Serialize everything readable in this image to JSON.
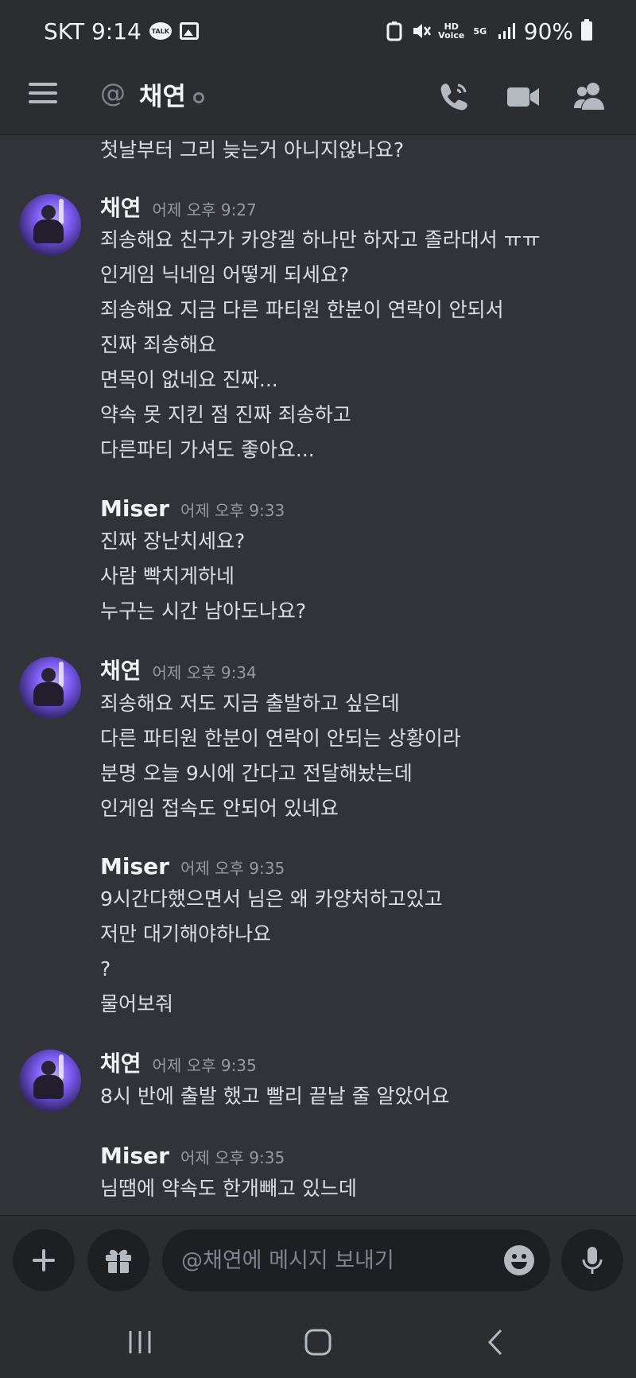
{
  "status_bar": {
    "carrier_time": "SKT 9:14",
    "talk_badge": "TALK",
    "hd_voice": "HD Voice",
    "network": "5G",
    "battery": "90%"
  },
  "header": {
    "at_symbol": "@",
    "channel_name": "채연"
  },
  "messages": {
    "prev_line": "첫날부터 그리 늦는거 아니지않나요?",
    "groups": [
      {
        "author": "채연",
        "time": "어제 오후 9:27",
        "lines": [
          "죄송해요 친구가 카양겔 하나만 하자고 졸라대서 ㅠㅠ",
          "인게임 닉네임 어떻게 되세요?",
          "죄송해요 지금 다른 파티원 한분이 연락이 안되서",
          "진짜 죄송해요",
          "면목이 없네요 진짜...",
          "약속 못 지킨 점 진짜 죄송하고",
          "다른파티 가셔도 좋아요..."
        ]
      },
      {
        "author": "Miser",
        "time": "어제 오후 9:33",
        "lines": [
          "진짜 장난치세요?",
          "사람 빡치게하네",
          "누구는 시간 남아도나요?"
        ]
      },
      {
        "author": "채연",
        "time": "어제 오후 9:34",
        "lines": [
          "죄송해요 저도 지금 출발하고 싶은데",
          "다른 파티원 한분이 연락이 안되는 상황이라",
          "분명 오늘 9시에 간다고 전달해놨는데",
          "인게임 접속도 안되어 있네요"
        ]
      },
      {
        "author": "Miser",
        "time": "어제 오후 9:35",
        "lines": [
          "9시간다했으면서 님은 왜 카양처하고있고",
          "저만 대기해야하나요",
          "?",
          "물어보줘"
        ]
      },
      {
        "author": "채연",
        "time": "어제 오후 9:35",
        "lines": [
          "8시 반에 출발 했고 빨리 끝날 줄 알았어요"
        ]
      },
      {
        "author": "Miser",
        "time": "어제 오후 9:35",
        "lines": [
          "님땜에 약속도 한개빼고 있느데"
        ]
      }
    ]
  },
  "composer": {
    "placeholder": "@채연에 메시지 보내기",
    "add_icon": "plus-icon",
    "gift_icon": "gift-icon",
    "emoji_icon": "smiley-icon",
    "mic_icon": "microphone-icon"
  },
  "colors": {
    "background": "#313338",
    "header": "#2b2d31",
    "input": "#1e1f22",
    "text": "#dbdee1",
    "muted": "#949ba4"
  }
}
